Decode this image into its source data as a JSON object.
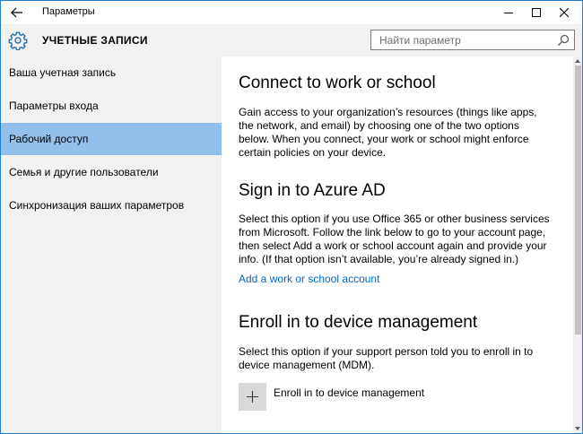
{
  "window": {
    "title": "Параметры",
    "back_icon": "back-arrow-icon",
    "controls": [
      "minimize-icon",
      "maximize-icon",
      "close-icon"
    ]
  },
  "header": {
    "section_icon": "gear-icon",
    "section_title": "УЧЕТНЫЕ ЗАПИСИ",
    "search_placeholder": "Найти параметр",
    "search_icon": "search-icon"
  },
  "sidebar": {
    "items": [
      {
        "label": "Ваша учетная запись"
      },
      {
        "label": "Параметры входа"
      },
      {
        "label": "Рабочий доступ",
        "active": true
      },
      {
        "label": "Семья и другие пользователи"
      },
      {
        "label": "Синхронизация ваших параметров"
      }
    ],
    "accent_color": "#90c0eb"
  },
  "main": {
    "connect": {
      "title": "Connect to work or school",
      "text": "Gain access to your organization’s resources (things like apps, the network, and email) by choosing one of the two options below. When you connect, your work or school might enforce certain policies on your device."
    },
    "azure": {
      "title": "Sign in to Azure AD",
      "text": "Select this option if you use Office 365 or other business services from Microsoft. Follow the link below to go to your account page, then select Add a work or school account again and provide your info. (If that option isn’t available, you’re already signed in.)",
      "link": "Add a work or school account"
    },
    "enroll": {
      "title": "Enroll in to device management",
      "text": "Select this option if your support person told you to enroll in to device management (MDM).",
      "button_label": "Enroll in to device management",
      "button_icon": "plus-icon"
    },
    "link_color": "#0067c0"
  }
}
